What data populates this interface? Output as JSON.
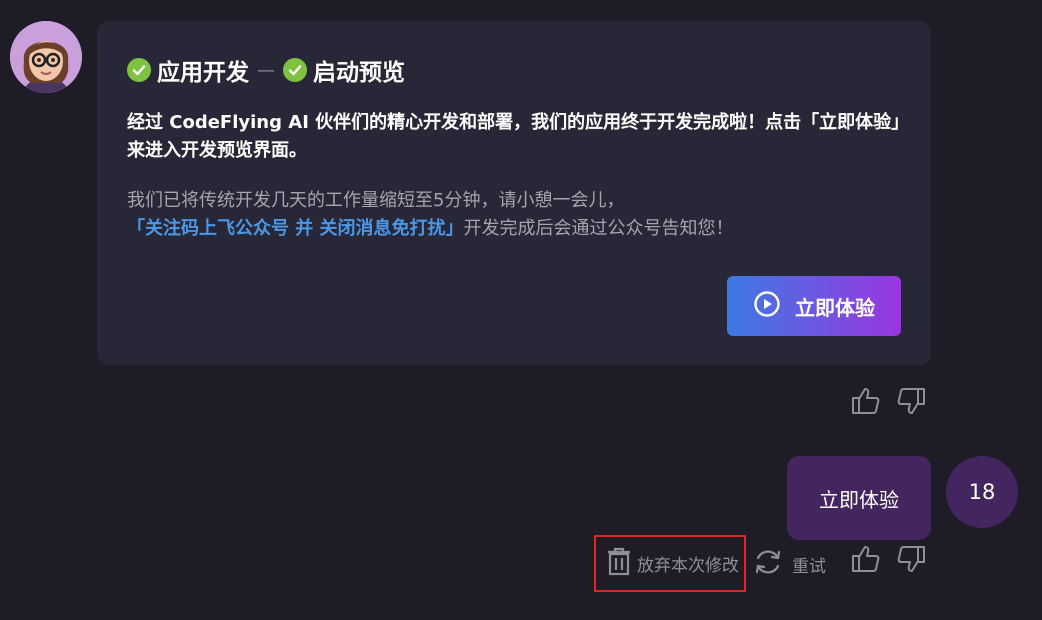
{
  "assistant": {
    "steps": [
      {
        "label": "应用开发"
      },
      {
        "label": "启动预览"
      }
    ],
    "step_separator": "—",
    "message": "经过 CodeFlying AI 伙伴们的精心开发和部署，我们的应用终于开发完成啦！点击「立即体验」来进入开发预览界面。",
    "note_line1": "我们已将传统开发几天的工作量缩短至5分钟，请小憩一会儿，",
    "note_link": "「关注码上飞公众号 并 关闭消息免打扰」",
    "note_line2_suffix": "开发完成后会通过公众号告知您！",
    "try_button_label": "立即体验"
  },
  "user": {
    "message": "立即体验",
    "avatar_label": "18"
  },
  "actions": {
    "discard_label": "放弃本次修改",
    "retry_label": "重试"
  },
  "colors": {
    "background": "#1e1d27",
    "card": "#272737",
    "check": "#7fc242",
    "link": "#4b97e8",
    "gradient_start": "#3d7ae3",
    "gradient_end": "#9a36de",
    "user_bubble": "#43265f",
    "highlight_border": "#e32424"
  },
  "icons": [
    "check-circle-icon",
    "play-circle-icon",
    "thumbs-up-icon",
    "thumbs-down-icon",
    "trash-icon",
    "refresh-icon"
  ]
}
